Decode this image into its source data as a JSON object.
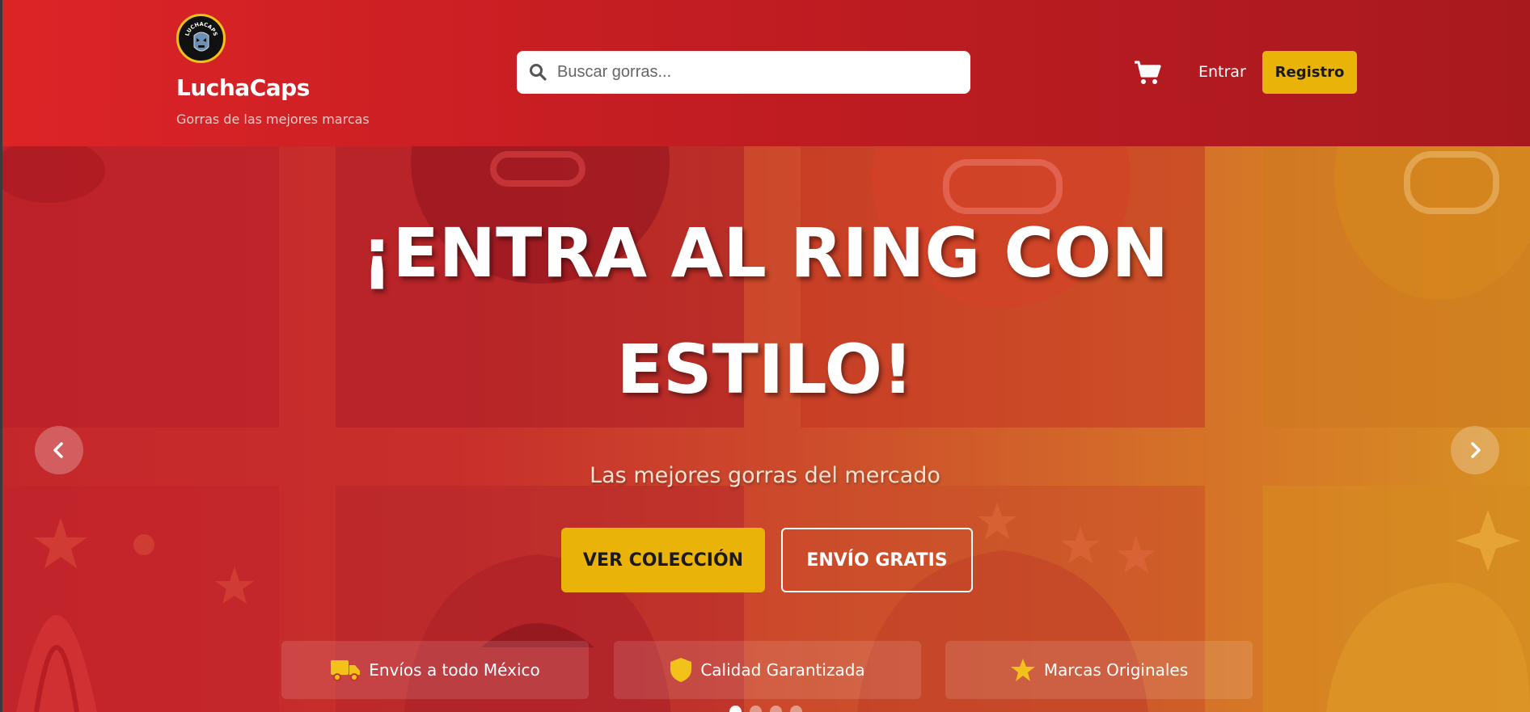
{
  "brand": {
    "name": "LuchaCaps",
    "tagline": "Gorras de las mejores marcas",
    "logo_text": "LUCHACAPS"
  },
  "search": {
    "placeholder": "Buscar gorras..."
  },
  "nav": {
    "login_label": "Entrar",
    "register_label": "Registro",
    "cart_icon": "cart-icon"
  },
  "hero": {
    "title": "¡ENTRA AL RING CON ESTILO!",
    "subtitle": "Las mejores gorras del mercado",
    "primary_button": "VER COLECCIÓN",
    "secondary_button": "ENVÍO GRATIS",
    "slide_count": 4,
    "active_slide": 1
  },
  "features": [
    {
      "icon": "truck-icon",
      "label": "Envíos a todo México"
    },
    {
      "icon": "shield-icon",
      "label": "Calidad Garantizada"
    },
    {
      "icon": "star-icon",
      "label": "Marcas Originales"
    }
  ],
  "colors": {
    "header_red": "#dd2427",
    "accent_yellow": "#eab308",
    "text_white": "#ffffff"
  }
}
